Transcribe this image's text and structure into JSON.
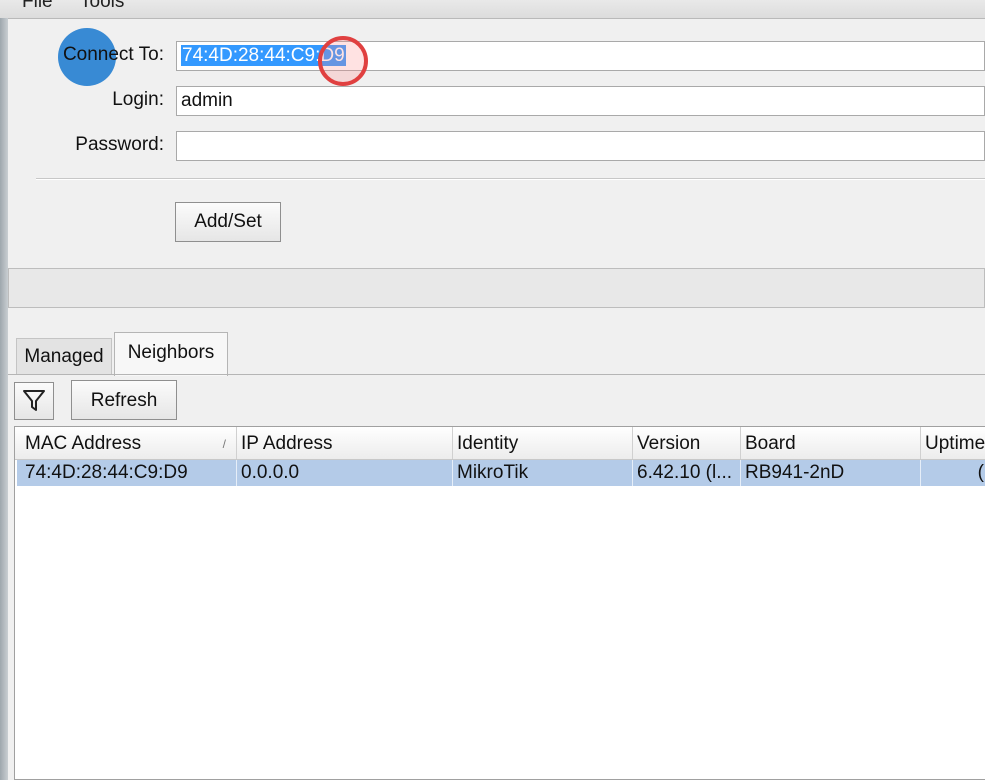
{
  "menu": [
    "File",
    "Tools"
  ],
  "form": {
    "connect_to_label": "Connect To:",
    "connect_to_value": "74:4D:28:44:C9:D9",
    "login_label": "Login:",
    "login_value": "admin",
    "password_label": "Password:",
    "password_value": "",
    "add_set_label": "Add/Set"
  },
  "tabs": [
    "Managed",
    "Neighbors"
  ],
  "active_tab": "Neighbors",
  "toolbar": {
    "filter_icon": "filter-icon",
    "refresh_label": "Refresh"
  },
  "table": {
    "columns": [
      "MAC Address",
      "IP Address",
      "Identity",
      "Version",
      "Board",
      "Uptime"
    ],
    "sort_indicator": "/",
    "rows": [
      [
        "74:4D:28:44:C9:D9",
        "0.0.0.0",
        "MikroTik",
        "6.42.10 (l...",
        "RB941-2nD",
        "("
      ]
    ]
  },
  "colors": {
    "selection": "#3399ff",
    "row_highlight": "#b4cbe8",
    "cursor": "#1778cf",
    "click_ring": "#e04040"
  }
}
